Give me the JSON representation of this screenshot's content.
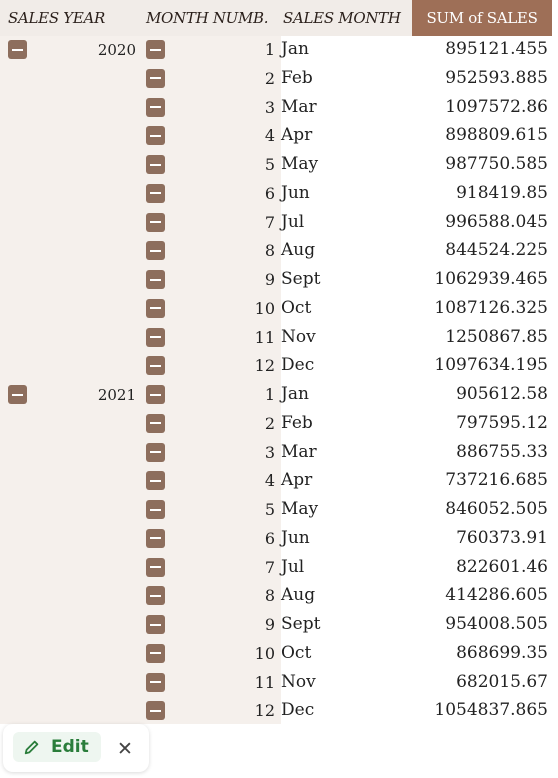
{
  "headers": {
    "sales_year": "SALES YEAR",
    "month_number": "MONTH NUMB.",
    "sales_month": "SALES MONTH",
    "sum_of_sales": "SUM of SALES"
  },
  "groups": [
    {
      "year": "2020",
      "rows": [
        {
          "num": "1",
          "month": "Jan",
          "sum": "895121.455"
        },
        {
          "num": "2",
          "month": "Feb",
          "sum": "952593.885"
        },
        {
          "num": "3",
          "month": "Mar",
          "sum": "1097572.86"
        },
        {
          "num": "4",
          "month": "Apr",
          "sum": "898809.615"
        },
        {
          "num": "5",
          "month": "May",
          "sum": "987750.585"
        },
        {
          "num": "6",
          "month": "Jun",
          "sum": "918419.85"
        },
        {
          "num": "7",
          "month": "Jul",
          "sum": "996588.045"
        },
        {
          "num": "8",
          "month": "Aug",
          "sum": "844524.225"
        },
        {
          "num": "9",
          "month": "Sept",
          "sum": "1062939.465"
        },
        {
          "num": "10",
          "month": "Oct",
          "sum": "1087126.325"
        },
        {
          "num": "11",
          "month": "Nov",
          "sum": "1250867.85"
        },
        {
          "num": "12",
          "month": "Dec",
          "sum": "1097634.195"
        }
      ]
    },
    {
      "year": "2021",
      "rows": [
        {
          "num": "1",
          "month": "Jan",
          "sum": "905612.58"
        },
        {
          "num": "2",
          "month": "Feb",
          "sum": "797595.12"
        },
        {
          "num": "3",
          "month": "Mar",
          "sum": "886755.33"
        },
        {
          "num": "4",
          "month": "Apr",
          "sum": "737216.685"
        },
        {
          "num": "5",
          "month": "May",
          "sum": "846052.505"
        },
        {
          "num": "6",
          "month": "Jun",
          "sum": "760373.91"
        },
        {
          "num": "7",
          "month": "Jul",
          "sum": "822601.46"
        },
        {
          "num": "8",
          "month": "Aug",
          "sum": "414286.605"
        },
        {
          "num": "9",
          "month": "Sept",
          "sum": "954008.505"
        },
        {
          "num": "10",
          "month": "Oct",
          "sum": "868699.35"
        },
        {
          "num": "11",
          "month": "Nov",
          "sum": "682015.67"
        },
        {
          "num": "12",
          "month": "Dec",
          "sum": "1054837.865"
        }
      ]
    }
  ],
  "toolbar": {
    "edit_label": "Edit",
    "close_label": "✕"
  },
  "colors": {
    "header_accent": "#9e6f57",
    "collapse_button": "#8d6e5d",
    "edit_green": "#2a7d3b"
  }
}
